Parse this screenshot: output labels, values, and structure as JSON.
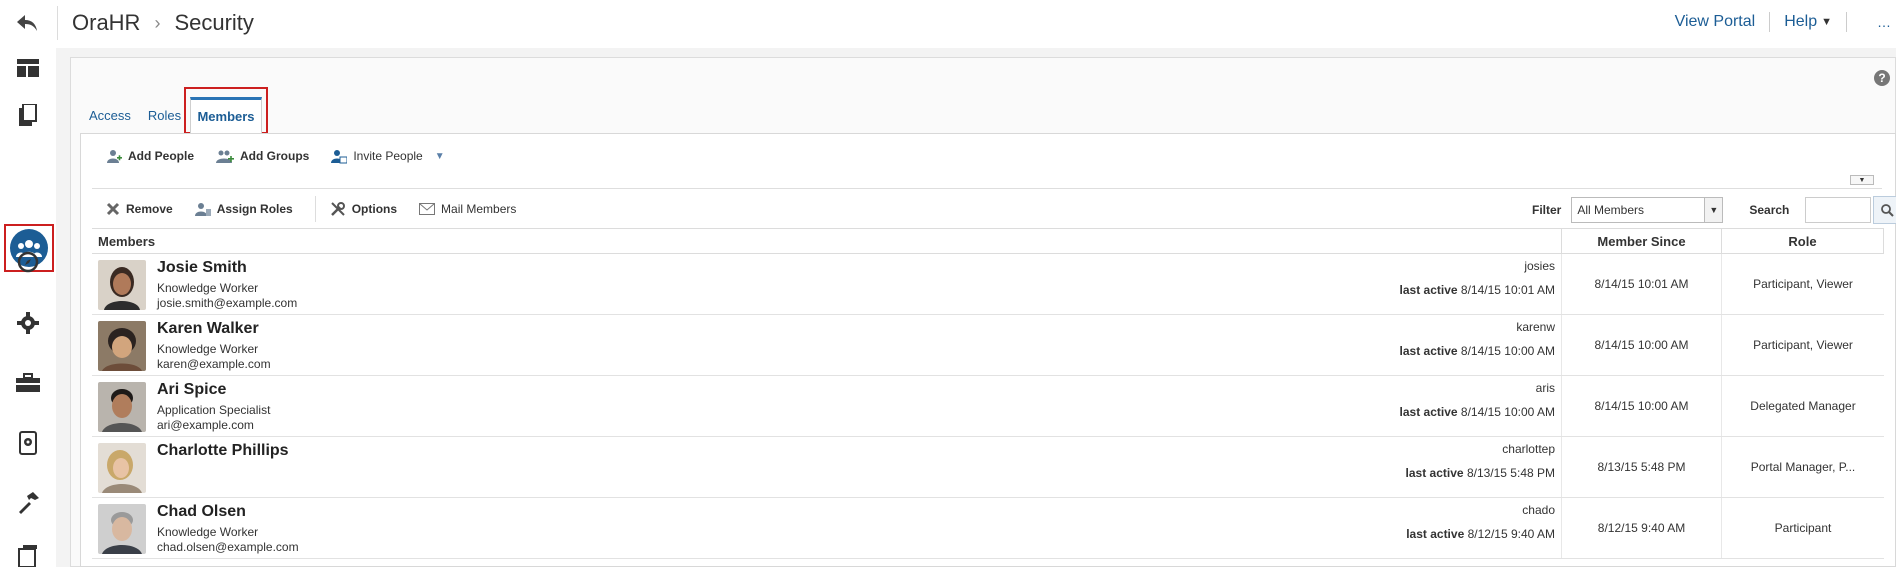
{
  "header": {
    "app_name": "OraHR",
    "page_title": "Security",
    "view_portal": "View Portal",
    "help": "Help"
  },
  "rail": {
    "items": [
      "layout-icon",
      "pages-icon",
      "members-icon",
      "compass-icon",
      "settings-gear-icon",
      "toolbox-icon",
      "device-settings-icon",
      "hammer-icon",
      "assets-icon"
    ],
    "active": "members-icon"
  },
  "tabs": {
    "access": "Access",
    "roles": "Roles",
    "members": "Members"
  },
  "toolbar": {
    "add_people": "Add People",
    "add_groups": "Add Groups",
    "invite_people": "Invite People",
    "remove": "Remove",
    "assign_roles": "Assign Roles",
    "options": "Options",
    "mail_members": "Mail Members",
    "filter_label": "Filter",
    "filter_value": "All Members",
    "search_label": "Search",
    "search_value": ""
  },
  "table": {
    "columns": [
      "Members",
      "Member Since",
      "Role"
    ],
    "last_active_label": "last active",
    "rows": [
      {
        "name": "Josie Smith",
        "title": "Knowledge Worker",
        "email": "josie.smith@example.com",
        "username": "josies",
        "last_active": "8/14/15 10:01 AM",
        "member_since": "8/14/15 10:01 AM",
        "role": "Participant, Viewer"
      },
      {
        "name": "Karen Walker",
        "title": "Knowledge Worker",
        "email": "karen@example.com",
        "username": "karenw",
        "last_active": "8/14/15 10:00 AM",
        "member_since": "8/14/15 10:00 AM",
        "role": "Participant, Viewer"
      },
      {
        "name": "Ari Spice",
        "title": "Application Specialist",
        "email": "ari@example.com",
        "username": "aris",
        "last_active": "8/14/15 10:00 AM",
        "member_since": "8/14/15 10:00 AM",
        "role": "Delegated Manager"
      },
      {
        "name": "Charlotte Phillips",
        "title": "",
        "email": "",
        "username": "charlottep",
        "last_active": "8/13/15 5:48 PM",
        "member_since": "8/13/15 5:48 PM",
        "role": "Portal Manager, P..."
      },
      {
        "name": "Chad Olsen",
        "title": "Knowledge Worker",
        "email": "chad.olsen@example.com",
        "username": "chado",
        "last_active": "8/12/15 9:40 AM",
        "member_since": "8/12/15 9:40 AM",
        "role": "Participant"
      }
    ]
  },
  "colors": {
    "accent": "#1c5d95",
    "highlight_border": "#cc1f1f",
    "tab_active_border": "#2a74b5"
  }
}
